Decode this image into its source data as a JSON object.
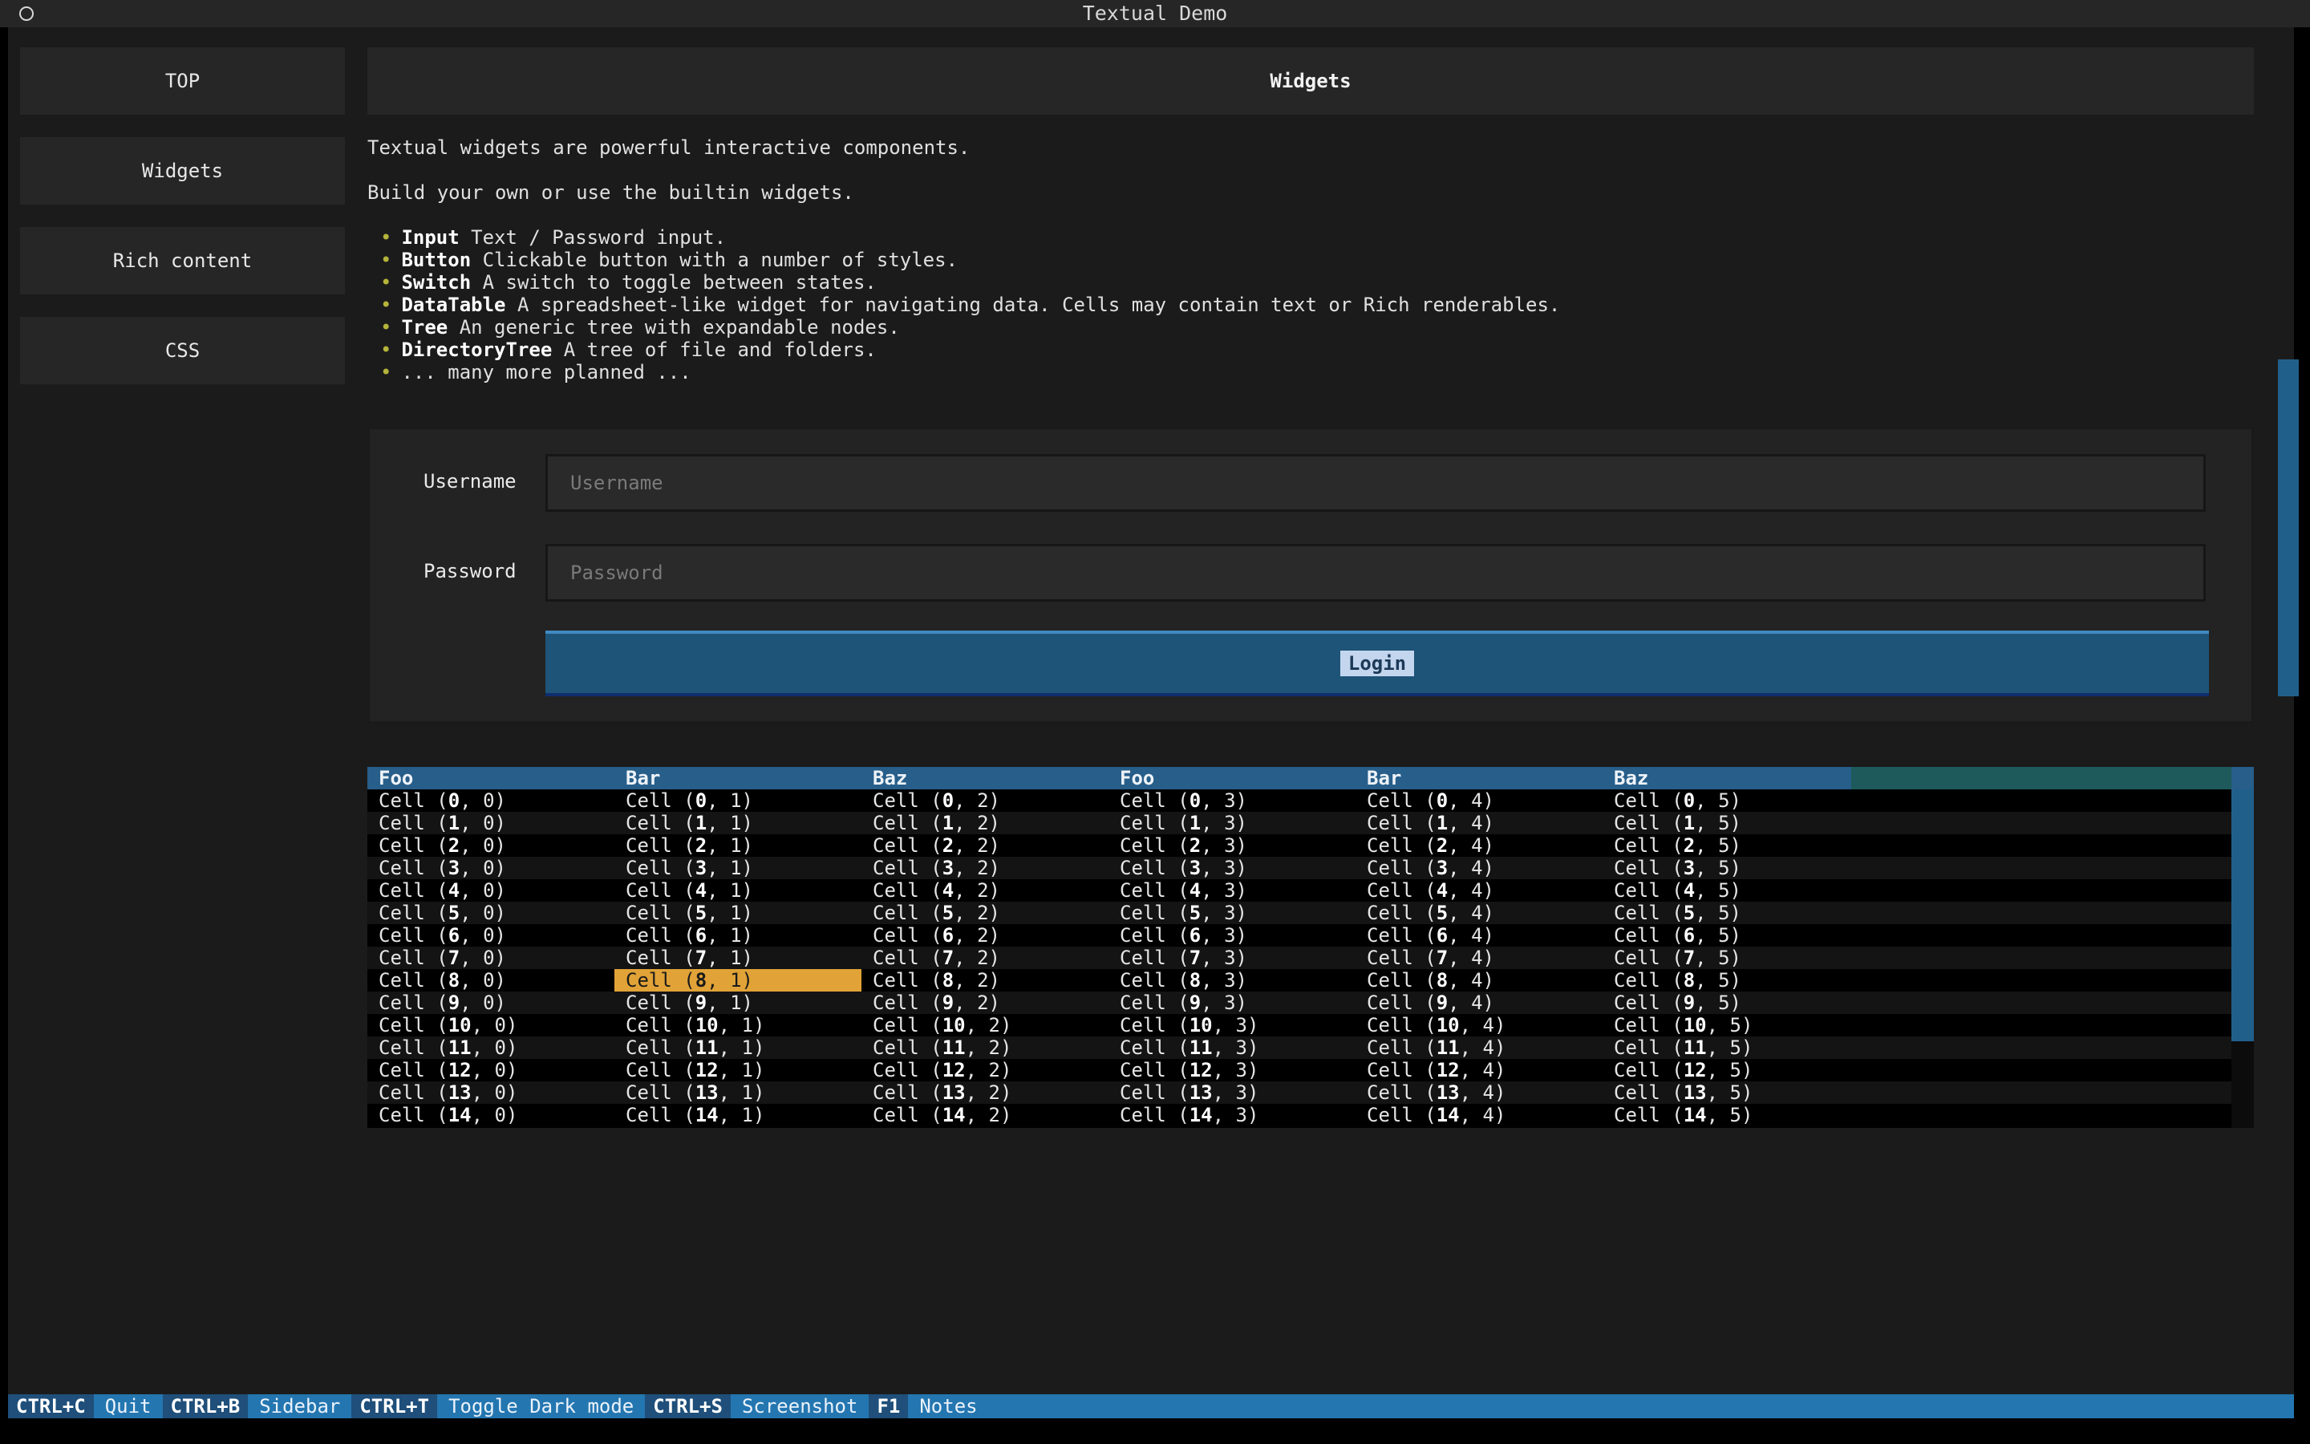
{
  "window": {
    "title": "Textual Demo"
  },
  "sidebar": {
    "items": [
      {
        "label": "TOP"
      },
      {
        "label": "Widgets"
      },
      {
        "label": "Rich content"
      },
      {
        "label": "CSS"
      }
    ]
  },
  "header": {
    "title": "Widgets"
  },
  "intro": {
    "line1": "Textual widgets are powerful interactive components.",
    "line2": "Build your own or use the builtin widgets.",
    "bullets": [
      {
        "term": "Input",
        "desc": " Text / Password input."
      },
      {
        "term": "Button",
        "desc": " Clickable button with a number of styles."
      },
      {
        "term": "Switch",
        "desc": " A switch to toggle between states."
      },
      {
        "term": "DataTable",
        "desc": " A spreadsheet-like widget for navigating data. Cells may contain text or Rich renderables."
      },
      {
        "term": "Tree",
        "desc": " An generic tree with expandable nodes."
      },
      {
        "term": "DirectoryTree",
        "desc": " A tree of file and folders."
      },
      {
        "term": "",
        "desc": "... many more planned ..."
      }
    ]
  },
  "form": {
    "username_label": "Username",
    "username_placeholder": "Username",
    "password_label": "Password",
    "password_placeholder": "Password",
    "login_label": "Login"
  },
  "table": {
    "columns": [
      "Foo",
      "Bar",
      "Baz",
      "Foo",
      "Bar",
      "Baz"
    ],
    "rows": [
      [
        "0",
        "0"
      ],
      [
        "1",
        "0"
      ],
      [
        "2",
        "0"
      ],
      [
        "3",
        "0"
      ],
      [
        "4",
        "0"
      ],
      [
        "5",
        "0"
      ],
      [
        "6",
        "0"
      ],
      [
        "7",
        "0"
      ],
      [
        "8",
        "0"
      ],
      [
        "9",
        "0"
      ],
      [
        "10",
        "0"
      ],
      [
        "11",
        "0"
      ],
      [
        "12",
        "0"
      ],
      [
        "13",
        "0"
      ],
      [
        "14",
        "0"
      ]
    ],
    "cell_prefix": "Cell (",
    "cell_sep": ", ",
    "cell_suffix": ")",
    "cursor": {
      "row": 8,
      "col": 1
    }
  },
  "footer": {
    "bindings": [
      {
        "key": "CTRL+C",
        "desc": "Quit"
      },
      {
        "key": "CTRL+B",
        "desc": "Sidebar"
      },
      {
        "key": "CTRL+T",
        "desc": "Toggle Dark mode"
      },
      {
        "key": "CTRL+S",
        "desc": "Screenshot"
      },
      {
        "key": "F1",
        "desc": "Notes"
      }
    ]
  },
  "colors": {
    "accent": "#2476b0",
    "cursor": "#e1a337",
    "background": "#1b1b1b"
  }
}
